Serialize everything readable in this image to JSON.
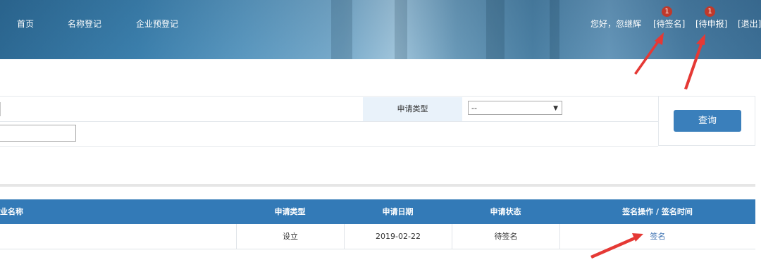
{
  "nav": {
    "home": "首页",
    "name_registration": "名称登记",
    "enterprise_pre_registration": "企业预登记"
  },
  "user_bar": {
    "greeting": "您好，忽继辉",
    "pending_sign": "[待签名]",
    "pending_sign_count": "1",
    "pending_submit": "[待申报]",
    "pending_submit_count": "1",
    "logout": "[退出]"
  },
  "search": {
    "application_type_label": "申请类型",
    "application_type_value": "--",
    "query_button": "查询"
  },
  "table": {
    "headers": [
      "业名称",
      "申请类型",
      "申请日期",
      "申请状态",
      "签名操作 / 签名时间"
    ],
    "rows": [
      {
        "name": "",
        "type": "设立",
        "date": "2019-02-22",
        "status": "待签名",
        "action": "签名"
      }
    ]
  },
  "colors": {
    "header_blue": "#337ab7",
    "button_blue": "#3a7fbb",
    "badge_red": "#c0392b",
    "arrow_red": "#e53935"
  }
}
